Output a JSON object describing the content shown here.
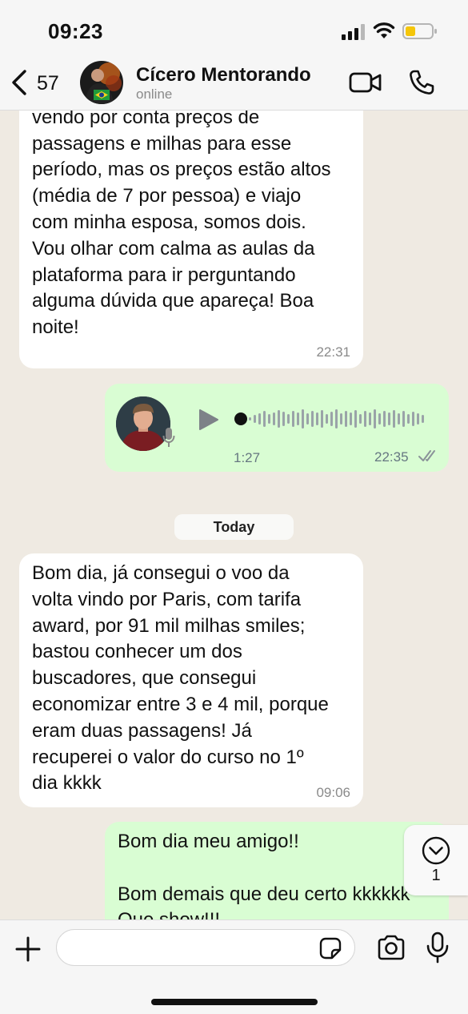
{
  "status_bar": {
    "time": "09:23",
    "battery_color": "#f5c60a"
  },
  "header": {
    "unread_count": "57",
    "contact_name": "Cícero Mentorando",
    "contact_status": "online"
  },
  "messages": [
    {
      "direction": "incoming",
      "text": "Londres, para Fortaleza. Estou\nvendo por conta preços de\npassagens e milhas para esse\nperíodo, mas os preços estão altos\n(média de 7 por pessoa) e viajo\ncom minha esposa, somos dois.\nVou olhar com calma as aulas da\nplataforma para ir perguntando\nalguma dúvida que apareça! Boa\nnoite!",
      "time": "22:31"
    },
    {
      "direction": "outgoing",
      "type": "voice",
      "duration": "1:27",
      "progress": 0,
      "time": "22:35",
      "status": "delivered"
    },
    {
      "type": "date_divider",
      "label": "Today"
    },
    {
      "direction": "incoming",
      "text": "Bom dia, já consegui o voo da\nvolta vindo por Paris, com tarifa\naward, por 91 mil milhas smiles;\nbastou conhecer um dos\nbuscadores, que consegui\neconomizar entre 3 e 4 mil, porque\neram duas passagens! Já\nrecuperei o valor do curso no 1º\ndia kkkk",
      "time": "09:06"
    },
    {
      "direction": "outgoing",
      "text": "Bom dia meu amigo!!\n\nBom demais que deu certo kkkkkk\nQue show!!!"
    }
  ],
  "scroll_button": {
    "unread_count": "1"
  },
  "input_bar": {
    "placeholder": "",
    "value": ""
  },
  "colors": {
    "incoming_bubble": "#ffffff",
    "outgoing_bubble": "#d9fdd3",
    "chat_background": "#efeae2",
    "bars": "#f6f6f6"
  }
}
